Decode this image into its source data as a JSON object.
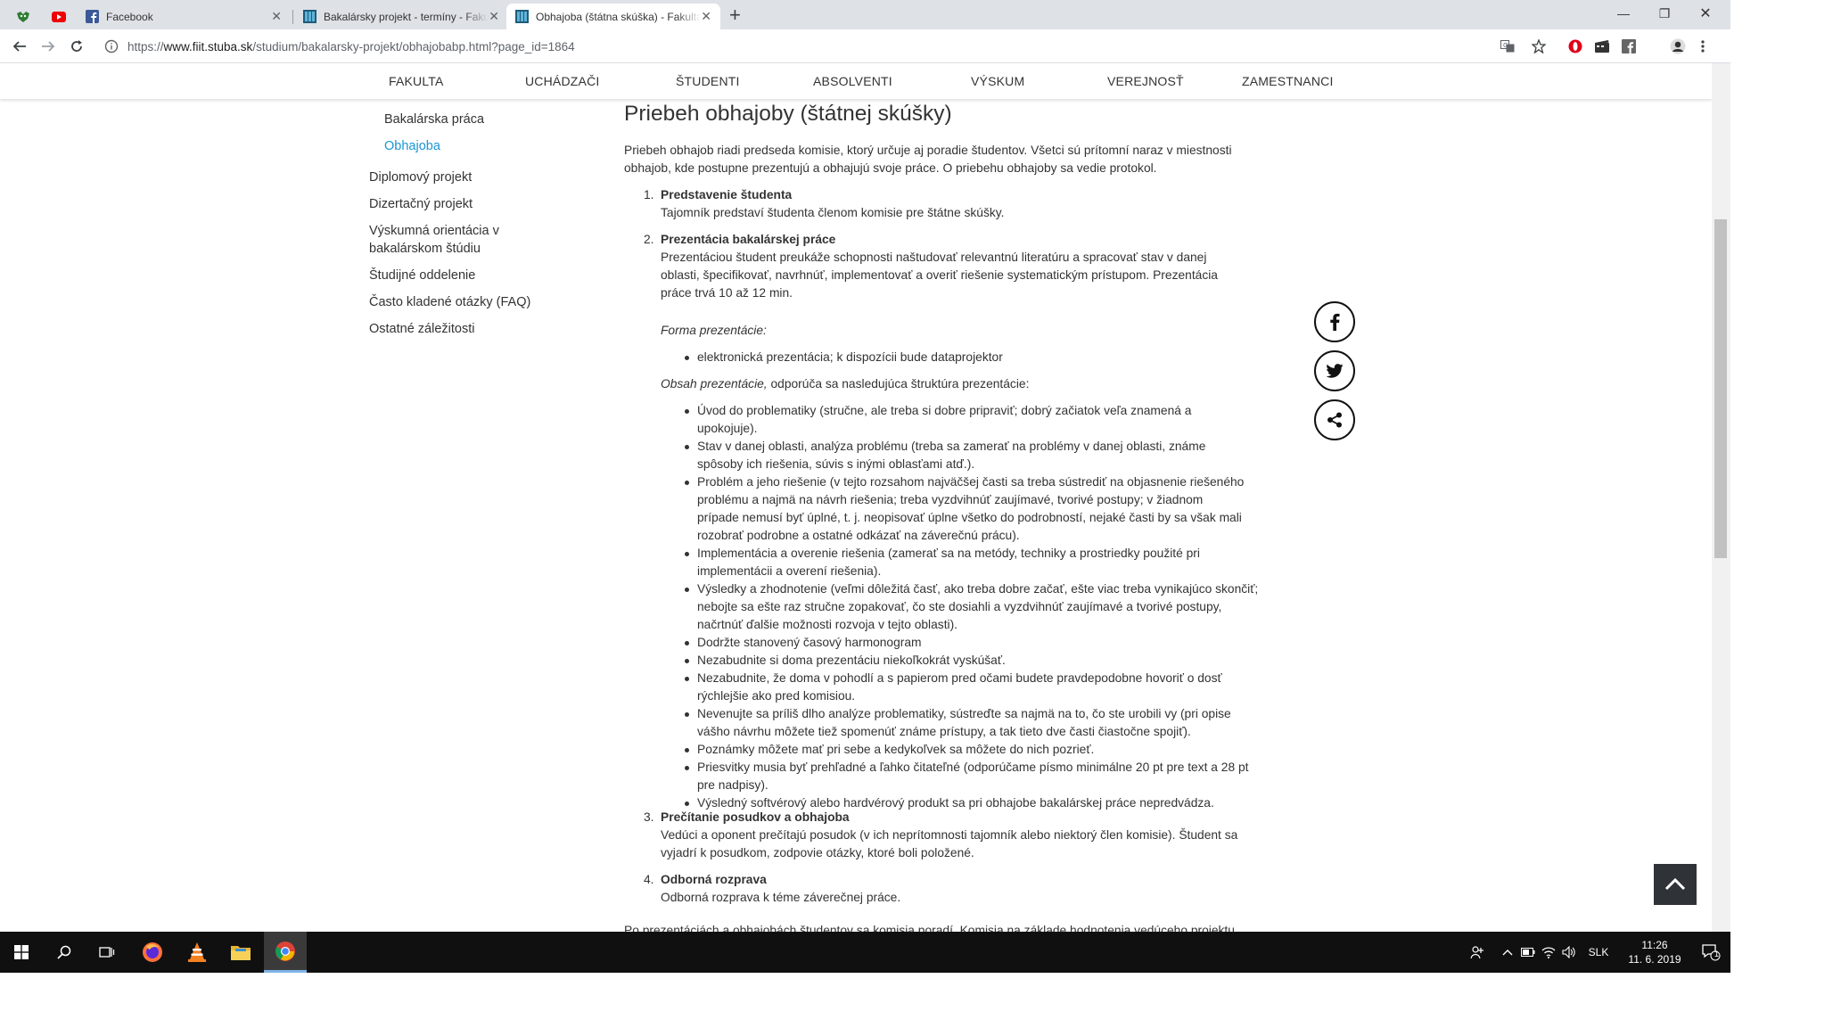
{
  "tabs": [
    {
      "title": "Facebook"
    },
    {
      "title": "Bakalársky projekt - termíny - Fakulta"
    },
    {
      "title": "Obhajoba (štátna skúška) - Fakulta"
    }
  ],
  "window_controls": {
    "minimize": "—",
    "restore": "❐",
    "close": "✕"
  },
  "address": {
    "protocol": "https://",
    "host": "www.fiit.stuba.sk",
    "path": "/studium/bakalarsky-projekt/obhajobabp.html?page_id=1864"
  },
  "main_nav": [
    "FAKULTA",
    "UCHÁDZAČI",
    "ŠTUDENTI",
    "ABSOLVENTI",
    "VÝSKUM",
    "VEREJNOSŤ",
    "ZAMESTNANCI"
  ],
  "sidebar": {
    "sub_items": [
      "Bakalárska práca",
      "Obhajoba"
    ],
    "items": [
      "Diplomový projekt",
      "Dizertačný projekt",
      "Výskumná orientácia v",
      "bakalárskom štúdiu",
      "Študijné oddelenie",
      "Často kladené otázky (FAQ)",
      "Ostatné záležitosti"
    ]
  },
  "content": {
    "title": "Priebeh obhajoby (štátnej skúšky)",
    "intro": [
      "Priebeh obhajob riadi predseda komisie, ktorý určuje aj poradie študentov. Všetci sú prítomní naraz v miestnosti",
      "obhajob, kde postupne prezentujú a obhajujú svoje práce. O priebehu obhajoby sa vedie protokol."
    ],
    "steps": [
      {
        "num": "1.",
        "title": "Predstavenie študenta",
        "lines": [
          "Tajomník predstaví študenta členom komisie pre štátne skúšky."
        ]
      },
      {
        "num": "2.",
        "title": "Prezentácia bakalárskej práce",
        "lines": [
          "Prezentáciou študent preukáže schopnosti naštudovať relevantnú literatúru a spracovať stav v danej",
          "oblasti, špecifikovať, navrhnúť, implementovať a overiť riešenie systematickým prístupom. Prezentácia",
          "práce trvá 10 až 12 min."
        ]
      },
      {
        "num": "3.",
        "title": "Prečítanie posudkov a obhajoba",
        "lines": [
          "Vedúci a oponent prečítajú posudok (v ich neprítomnosti tajomník alebo niektorý člen komisie). Študent sa",
          "vyjadrí k posudkom, zodpovie otázky, ktoré boli položené."
        ]
      },
      {
        "num": "4.",
        "title": "Odborná rozprava",
        "lines": [
          "Odborná rozprava k téme záverečnej práce."
        ]
      }
    ],
    "forma_label": "Forma prezentácie:",
    "forma_items": [
      "elektronická prezentácia; k dispozícii bude dataprojektor"
    ],
    "obsah_label": "Obsah prezentácie,",
    "obsah_rest": " odporúča sa nasledujúca štruktúra prezentácie:",
    "obsah_items": [
      [
        "Úvod do problematiky (stručne, ale treba si dobre pripraviť; dobrý začiatok veľa znamená a",
        "upokojuje)."
      ],
      [
        "Stav v danej oblasti, analýza problému (treba sa zamerať na problémy v danej oblasti, známe",
        "spôsoby ich riešenia, súvis s inými oblasťami atď.)."
      ],
      [
        "Problém a jeho riešenie (v tejto rozsahom najväčšej časti sa treba sústrediť na objasnenie riešeného",
        "problému a najmä na návrh riešenia; treba vyzdvihnúť zaujímavé, tvorivé postupy; v žiadnom",
        "prípade nemusí byť úplné, t. j. neopisovať úplne všetko do podrobností, nejaké časti by sa však mali",
        "rozobrať podrobne a ostatné odkázať na záverečnú prácu)."
      ],
      [
        "Implementácia a overenie riešenia (zamerať sa na metódy, techniky a prostriedky použité pri",
        "implementácii a overení riešenia)."
      ],
      [
        "Výsledky a zhodnotenie (veľmi dôležitá časť, ako treba dobre začať, ešte viac treba vynikajúco skončiť;",
        "nebojte sa ešte raz stručne zopakovať, čo ste dosiahli a vyzdvihnúť zaujímavé a tvorivé postupy,",
        "načrtnúť ďalšie možnosti rozvoja v tejto oblasti)."
      ],
      [
        "Dodržte stanovený časový harmonogram"
      ],
      [
        "Nezabudnite si doma prezentáciu niekoľkokrát vyskúšať."
      ],
      [
        "Nezabudnite, že doma v pohodlí a s papierom pred očami budete pravdepodobne hovoriť o dosť",
        "rýchlejšie ako pred komisiou."
      ],
      [
        "Nevenujte sa príliš dlho analýze problematiky, sústreďte sa najmä na to, čo ste urobili vy (pri opise",
        "vášho návrhu môžete tiež spomenúť známe prístupy, a tak tieto dve časti čiastočne spojiť)."
      ],
      [
        "Poznámky môžete mať pri sebe a kedykoľvek sa môžete do nich pozrieť."
      ],
      [
        "Priesvitky musia byť prehľadné a ľahko čitateľné (odporúčame písmo minimálne 20 pt pre text a 28 pt",
        "pre nadpisy)."
      ],
      [
        "Výsledný softvérový alebo hardvérový produkt sa pri obhajobe bakalárskej práce nepredvádza."
      ]
    ],
    "trailing": "Po prezentáciách a obhajobách študentov sa komisia poradí. Komisia na základe hodnotenia vedúceho projektu"
  },
  "taskbar": {
    "language": "SLK",
    "time": "11:26",
    "date": "11. 6. 2019",
    "notifications": "1"
  },
  "icons": [
    "back-icon",
    "forward-icon",
    "reload-icon",
    "info-icon",
    "translate-icon",
    "star-icon",
    "opera-icon",
    "film-icon",
    "facebook-icon",
    "profile-icon",
    "menu-icon",
    "facebook-share-icon",
    "twitter-share-icon",
    "share-icon",
    "chevron-up-icon",
    "windows-start-icon",
    "search-icon",
    "task-view-icon",
    "firefox-icon",
    "vlc-icon",
    "file-explorer-icon",
    "chrome-icon"
  ],
  "colors": {
    "active_link": "#1a96d4",
    "tab_bar": "#dee1e6",
    "taskbar": "#101010",
    "scroll_top_button": "#2f3237"
  }
}
